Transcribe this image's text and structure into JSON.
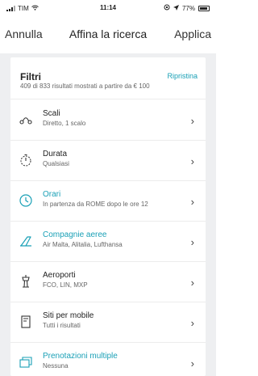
{
  "status_bar": {
    "carrier": "TIM",
    "time": "11:14",
    "battery": "77%"
  },
  "nav": {
    "cancel": "Annulla",
    "title": "Affina la ricerca",
    "apply": "Applica"
  },
  "filters": {
    "title": "Filtri",
    "reset": "Ripristina",
    "results": "409 di 833 risultati mostrati a partire da € 100"
  },
  "rows": [
    {
      "title": "Scali",
      "subtitle": "Diretto, 1 scalo",
      "icon": "route-icon"
    },
    {
      "title": "Durata",
      "subtitle": "Qualsiasi",
      "icon": "stopwatch-icon"
    },
    {
      "title": "Orari",
      "subtitle": "In partenza da ROME dopo le ore 12",
      "icon": "clock-icon",
      "active": true
    },
    {
      "title": "Compagnie aeree",
      "subtitle": "Air Malta, Alitalia, Lufthansa",
      "icon": "plane-tail-icon",
      "active": true
    },
    {
      "title": "Aeroporti",
      "subtitle": "FCO, LIN, MXP",
      "icon": "control-tower-icon"
    },
    {
      "title": "Siti per mobile",
      "subtitle": "Tutti i risultati",
      "icon": "mobile-site-icon"
    },
    {
      "title": "Prenotazioni multiple",
      "subtitle": "Nessuna",
      "icon": "multi-booking-icon",
      "active": true
    }
  ],
  "colors": {
    "accent": "#1aa0b6",
    "background": "#eeeff1"
  }
}
